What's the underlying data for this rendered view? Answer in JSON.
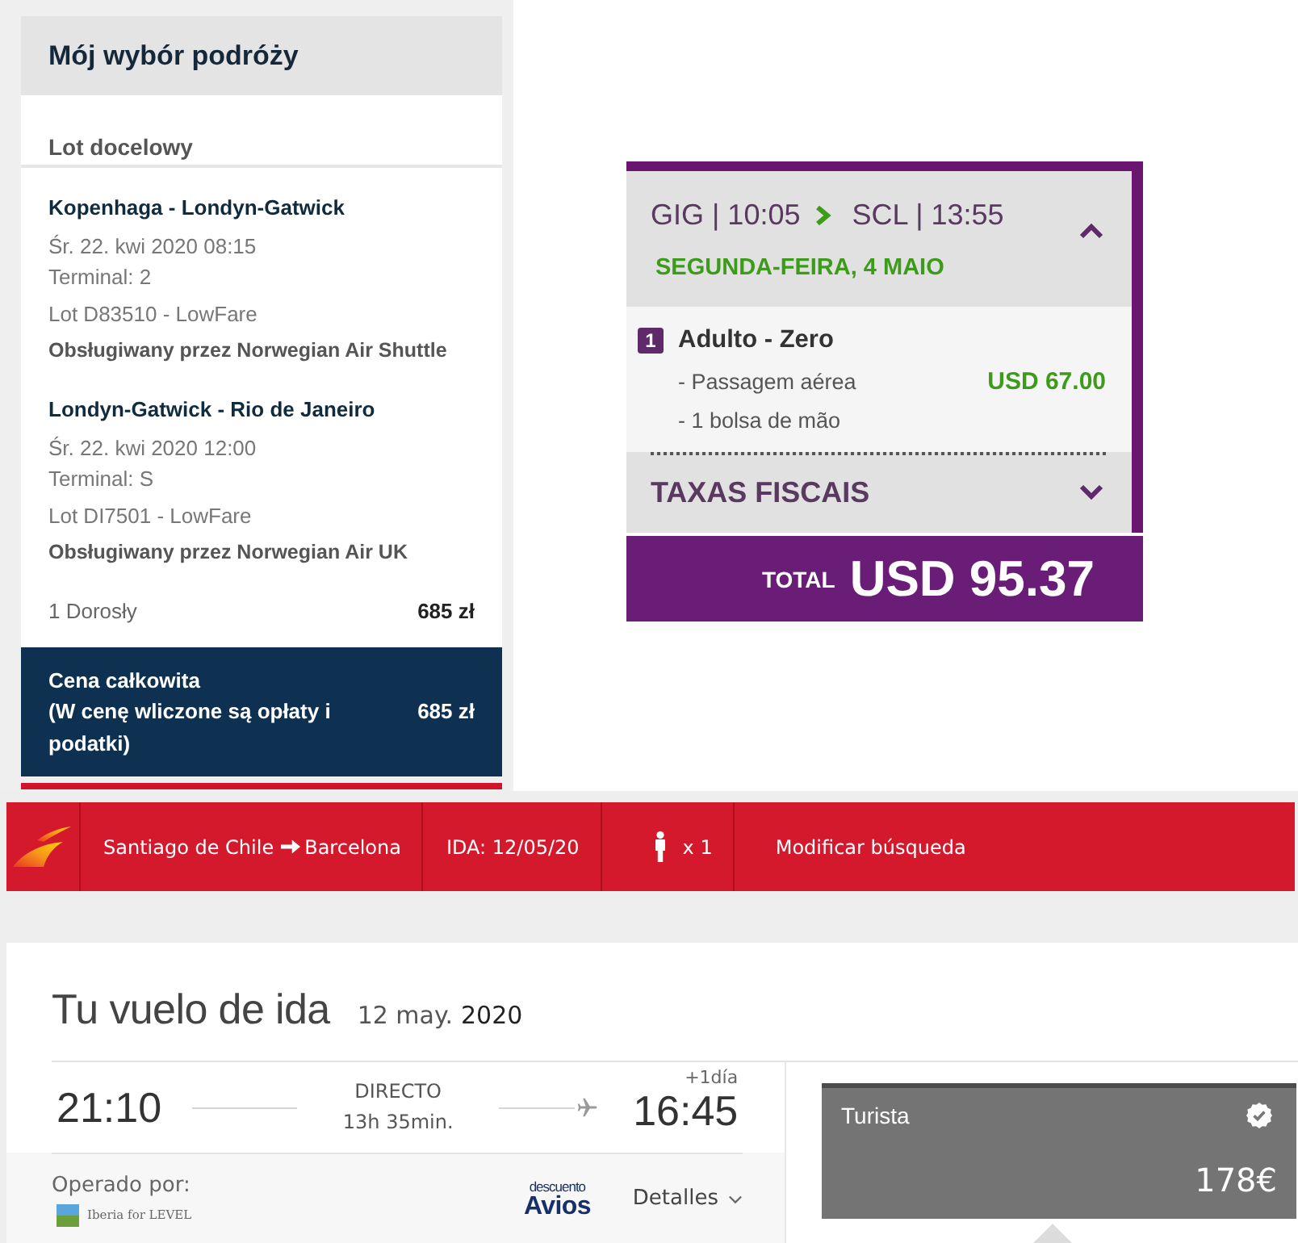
{
  "trip_summary": {
    "title": "Mój wybór podróży",
    "section_title": "Lot docelowy",
    "flights": [
      {
        "route": "Kopenhaga - Londyn-Gatwick",
        "datetime": "Śr. 22. kwi 2020 08:15",
        "terminal": "Terminal: 2",
        "flight": "Lot D83510 - LowFare",
        "operator": "Obsługiwany przez Norwegian Air Shuttle"
      },
      {
        "route": "Londyn-Gatwick - Rio de Janeiro",
        "datetime": "Śr. 22. kwi 2020 12:00",
        "terminal": "Terminal: S",
        "flight": "Lot DI7501 - LowFare",
        "operator": "Obsługiwany przez Norwegian Air UK"
      }
    ],
    "passengers": {
      "label": "1 Dorosły",
      "price": "685 zł"
    },
    "total": {
      "label": "Cena całkowita",
      "note": "(W cenę wliczone są opłaty i podatki)",
      "price": "685 zł"
    }
  },
  "fare_breakdown": {
    "segment": {
      "departure": "GIG | 10:05",
      "arrival": "SCL | 13:55",
      "date": "SEGUNDA-FEIRA, 4 MAIO",
      "expanded": true
    },
    "passenger": {
      "count": "1",
      "label": "Adulto - Zero",
      "items": [
        {
          "text": "- Passagem aérea",
          "price": "USD 67.00"
        },
        {
          "text": "- 1 bolsa de mão"
        }
      ]
    },
    "taxes": {
      "label": "TAXAS FISCAIS",
      "expanded": false
    },
    "total": {
      "label": "TOTAL",
      "amount": "USD 95.37"
    }
  },
  "search_bar": {
    "route_from": "Santiago de Chile",
    "route_to": "Barcelona",
    "departure": "IDA: 12/05/20",
    "passengers": "x 1",
    "modify": "Modificar búsqueda"
  },
  "flight_result": {
    "title": "Tu vuelo de ida",
    "date": "12 may.",
    "year": "2020",
    "departure": "21:10",
    "stops": "DIRECTO",
    "duration": "13h 35min.",
    "day_offset": "+1día",
    "arrival": "16:45",
    "operated_label": "Operado por:",
    "operator": "Iberia for LEVEL",
    "avios_note": "descuento",
    "avios": "Avios",
    "details": "Detalles",
    "fare": {
      "name": "Turista",
      "price": "178€",
      "selected": true
    }
  }
}
